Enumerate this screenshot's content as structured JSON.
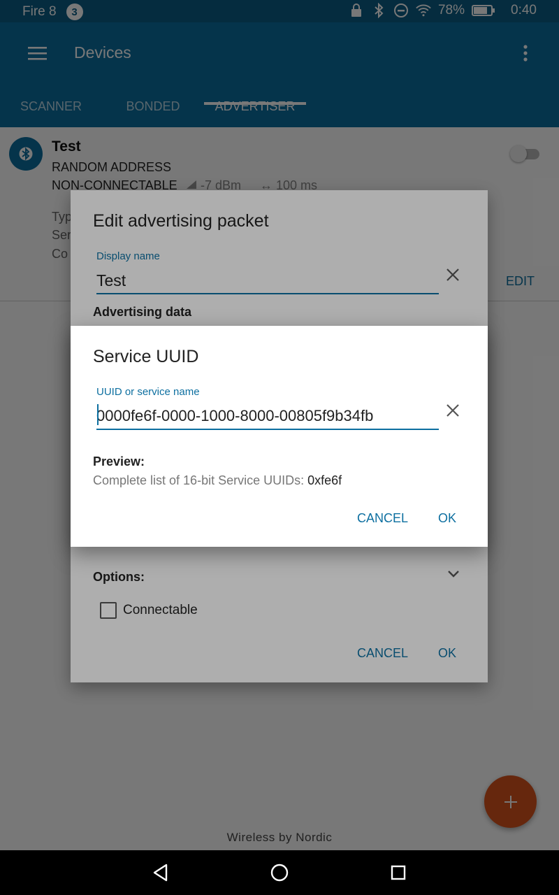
{
  "status_bar": {
    "device_name": "Fire 8",
    "notification_count": "3",
    "battery_percent": "78%",
    "time": "0:40",
    "icons": [
      "lock-icon",
      "bluetooth-icon",
      "do-not-disturb-icon",
      "wifi-icon",
      "battery-icon"
    ]
  },
  "app_bar": {
    "title": "Devices",
    "tabs": [
      {
        "label": "SCANNER"
      },
      {
        "label": "BONDED"
      },
      {
        "label": "ADVERTISER"
      }
    ],
    "active_tab": "ADVERTISER"
  },
  "device": {
    "name": "Test",
    "address_type": "RANDOM ADDRESS",
    "connectable": "NON-CONNECTABLE",
    "tx_power": "-7 dBm",
    "interval": "100 ms",
    "detail_labels": [
      "Typ",
      "Ser",
      "Co"
    ],
    "edit_label": "EDIT"
  },
  "edit_dialog": {
    "title": "Edit advertising packet",
    "display_name_label": "Display name",
    "display_name_value": "Test",
    "advertising_data_label": "Advertising data",
    "options_label": "Options:",
    "connectable_label": "Connectable",
    "connectable_checked": false,
    "cancel_label": "CANCEL",
    "ok_label": "OK"
  },
  "uuid_dialog": {
    "title": "Service UUID",
    "input_label": "UUID or service name",
    "input_value": "0000fe6f-0000-1000-8000-00805f9b34fb",
    "preview_heading": "Preview:",
    "preview_text": "Complete list of 16-bit Service UUIDs:",
    "preview_value": "0xfe6f",
    "cancel_label": "CANCEL",
    "ok_label": "OK"
  },
  "footer": {
    "text": "Wireless by Nordic"
  },
  "colors": {
    "primary": "#0d6fa0",
    "primary_dark": "#0d5f86",
    "accent": "#d9531e"
  }
}
